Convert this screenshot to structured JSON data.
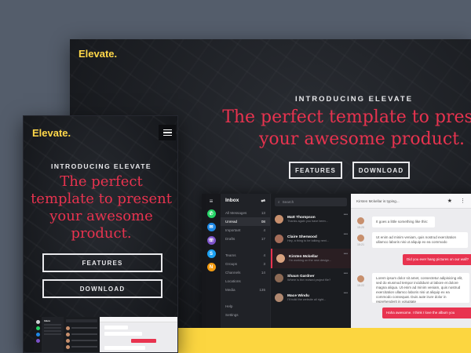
{
  "desktop": {
    "brand": "Elevate.",
    "intro": "INTRODUCING ELEVATE",
    "headline": "The perfect template to present your awesome product.",
    "buttons": {
      "features": "FEATURES",
      "download": "DOWNLOAD"
    },
    "app": {
      "folders_title": "Inbox",
      "folders": [
        {
          "label": "All Messages",
          "count": "13"
        },
        {
          "label": "Unread",
          "count": "08"
        },
        {
          "label": "Important",
          "count": "4"
        },
        {
          "label": "Drafts",
          "count": "17"
        }
      ],
      "groups": [
        {
          "label": "Teams",
          "count": "4"
        },
        {
          "label": "Groups",
          "count": "3"
        },
        {
          "label": "Channels",
          "count": "14"
        },
        {
          "label": "Locations",
          "count": ""
        },
        {
          "label": "Media",
          "count": "135"
        }
      ],
      "footer_items": [
        {
          "label": "Help"
        },
        {
          "label": "Settings"
        }
      ],
      "search_placeholder": "Search",
      "threads": [
        {
          "name": "Matt Thompson",
          "preview": "Thanks again you have been...",
          "active": false
        },
        {
          "name": "Claire Sherwood",
          "preview": "Hey, a thing to be talking next...",
          "active": false
        },
        {
          "name": "Kirsten Mckellar",
          "preview": "I'm working on the new design...",
          "active": true
        },
        {
          "name": "Shaun Gardner",
          "preview": "Where is the revised project file?",
          "active": false
        },
        {
          "name": "Mace Windu",
          "preview": "I'll build the website all right...",
          "active": false
        }
      ],
      "chat": {
        "typing": "Kirsten Mckellar is typing...",
        "messages": [
          {
            "dir": "in",
            "text": "It goes a little something like this:",
            "time": "15:20"
          },
          {
            "dir": "in",
            "text": "Ut enim ad minim veniam, quis nostrud exercitation ullamco laboris nisi ut aliquip ex ea commodo",
            "time": "15:21"
          },
          {
            "dir": "out",
            "text": "Did you ever hang pictures on our wall?"
          },
          {
            "dir": "in",
            "text": "Lorem ipsum dolor sit amet, consectetur adipisicing elit, sed do eiusmod tempor incididunt ut labore et dolore magna aliqua. Ut enim ad minim veniam, quis nostrud exercitation ullamco laboris nisi ut aliquip ex ea commodo consequat. Duis aute irure dolor in reprehenderit in voluptate",
            "time": "15:22"
          },
          {
            "dir": "out",
            "text": "Haha awesome. I think I love the album you"
          }
        ]
      }
    }
  },
  "mobile": {
    "brand": "Elevate.",
    "intro": "INTRODUCING ELEVATE",
    "headline": "The perfect template to present your awesome product.",
    "buttons": {
      "features": "FEATURES",
      "download": "DOWNLOAD"
    },
    "mini_app_title": "Inbox"
  },
  "colors": {
    "brand_yellow": "#ffd84a",
    "accent_red": "#e8334f",
    "page_bg": "#545d6b",
    "band_yellow": "#fcd640"
  },
  "icons": {
    "rail": [
      "menu-icon",
      "whatsapp-icon",
      "messenger-icon",
      "viber-icon",
      "skype-icon",
      "notification-icon"
    ],
    "chat_actions": [
      "star-icon",
      "more-icon"
    ]
  }
}
